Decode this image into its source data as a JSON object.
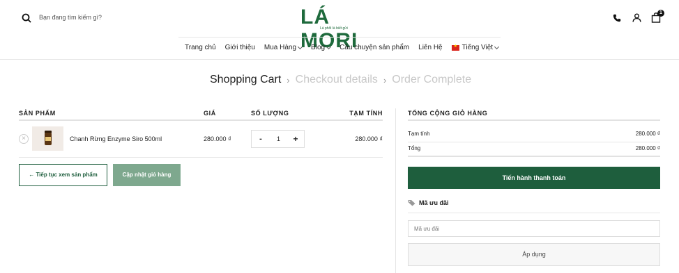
{
  "header": {
    "search_placeholder": "Bạn đang tìm kiếm gì?",
    "logo_text": "LÁ MORI",
    "logo_tagline": "Lá phổi là biết gửi",
    "cart_count": "1",
    "icons": [
      "search-icon",
      "phone-icon",
      "user-icon",
      "cart-icon"
    ]
  },
  "nav": {
    "items": [
      {
        "label": "Trang chủ"
      },
      {
        "label": "Giới thiệu"
      },
      {
        "label": "Mua Hàng"
      },
      {
        "label": "Blog"
      },
      {
        "label": "Câu chuyện sản phẩm"
      },
      {
        "label": "Liên Hệ"
      },
      {
        "label": "Tiếng Việt"
      }
    ]
  },
  "steps": {
    "step1": "Shopping Cart",
    "step2": "Checkout details",
    "step3": "Order Complete",
    "separator": "›"
  },
  "cart": {
    "columns": {
      "product": "SẢN PHẨM",
      "price": "GIÁ",
      "quantity": "SỐ LƯỢNG",
      "subtotal": "TẠM TÍNH"
    },
    "items": [
      {
        "name": "Chanh Rừng Enzyme Siro 500ml",
        "price": "280.000 ₫",
        "quantity": "1",
        "subtotal": "280.000 ₫"
      }
    ],
    "remove_symbol": "×",
    "minus_label": "-",
    "plus_label": "+",
    "continue_label": "← Tiếp tục xem sản phẩm",
    "update_label": "Cập nhật giỏ hàng"
  },
  "totals": {
    "title": "TỔNG CỘNG GIỎ HÀNG",
    "subtotal_label": "Tạm tính",
    "subtotal_value": "280.000 ₫",
    "total_label": "Tổng",
    "total_value": "280.000 ₫",
    "checkout_label": "Tiến hành thanh toán",
    "coupon_title": "Mã ưu đãi",
    "coupon_placeholder": "Mã ưu đãi",
    "apply_label": "Áp dụng"
  },
  "colors": {
    "brand_green": "#1e5e3d",
    "logo_green": "#1e6a3c",
    "update_button": "#7ea88e"
  }
}
